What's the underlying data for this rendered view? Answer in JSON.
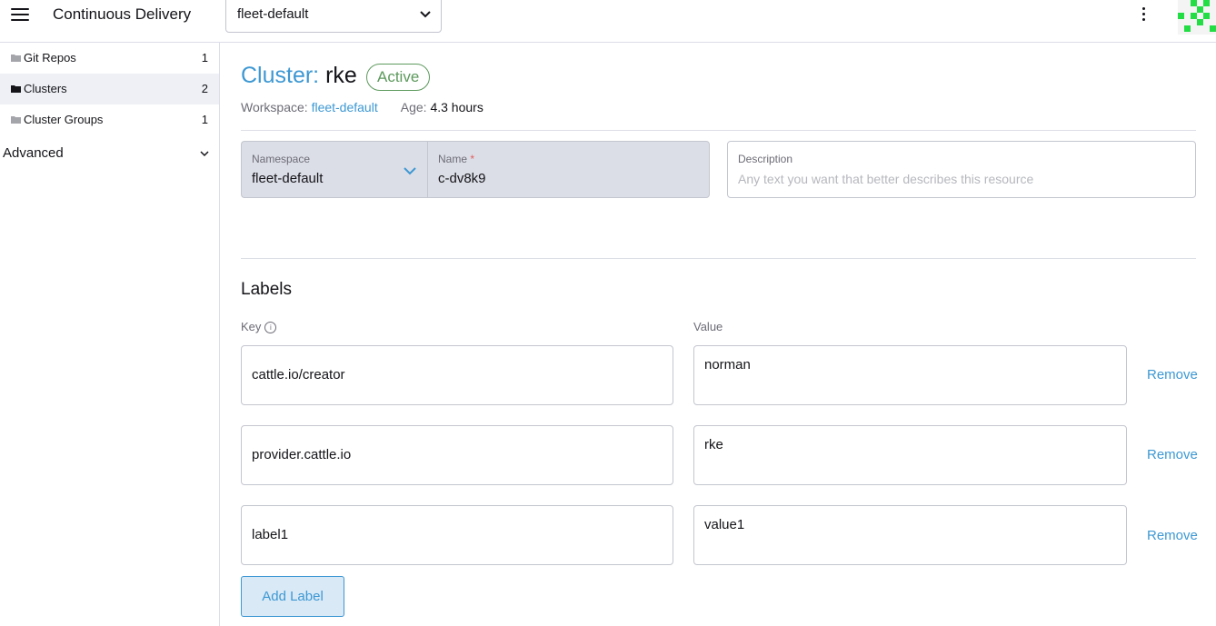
{
  "header": {
    "app_title": "Continuous Delivery",
    "workspace_selected": "fleet-default"
  },
  "sidebar": {
    "items": [
      {
        "label": "Git Repos",
        "count": "1"
      },
      {
        "label": "Clusters",
        "count": "2"
      },
      {
        "label": "Cluster Groups",
        "count": "1"
      }
    ],
    "advanced_label": "Advanced"
  },
  "page": {
    "kind": "Cluster:",
    "name": "rke",
    "status": "Active",
    "workspace_label": "Workspace:",
    "workspace_value": "fleet-default",
    "age_label": "Age:",
    "age_value": "4.3 hours"
  },
  "form": {
    "namespace_label": "Namespace",
    "namespace_value": "fleet-default",
    "name_label": "Name",
    "name_required": "*",
    "name_value": "c-dv8k9",
    "description_label": "Description",
    "description_placeholder": "Any text you want that better describes this resource"
  },
  "labels": {
    "title": "Labels",
    "key_header": "Key",
    "value_header": "Value",
    "remove_label": "Remove",
    "add_label": "Add Label",
    "rows": [
      {
        "key": "cattle.io/creator",
        "value": "norman"
      },
      {
        "key": "provider.cattle.io",
        "value": "rke"
      },
      {
        "key": "label1",
        "value": "value1"
      }
    ]
  },
  "colors": {
    "accent": "#3d98d3",
    "active": "#5d995d",
    "logo": "#22dd44"
  }
}
